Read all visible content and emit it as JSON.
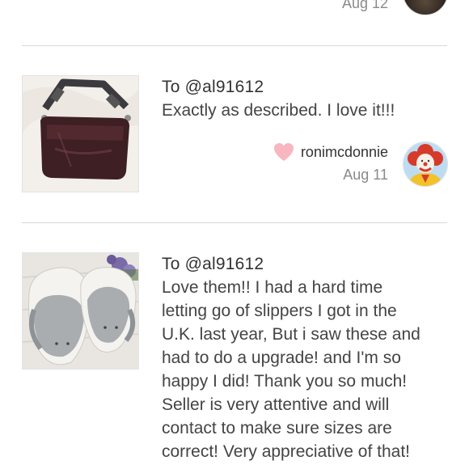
{
  "top": {
    "date": "Aug 12"
  },
  "reviews": [
    {
      "to": "To @al91612",
      "text": "Exactly as described. I love it!!!",
      "author": "ronimcdonnie",
      "date": "Aug 11",
      "liked": true,
      "heart_color": "#f7b6c0",
      "thumb_icon": "messenger-bag-photo",
      "avatar_icon": "clown-avatar"
    },
    {
      "to": "To @al91612",
      "text_lines": [
        "Love them!! I had a hard time",
        "letting go of slippers I got in the",
        "U.K. last year, But i saw these and",
        "had to do a upgrade! and I'm so",
        "happy I did! Thank you so much!",
        "Seller is very attentive and will",
        "contact to make sure sizes are",
        "correct! Very appreciative of that!"
      ],
      "thumb_icon": "slippers-photo"
    }
  ],
  "colors": {
    "divider": "#d9d9d9",
    "muted_text": "#8a8a8a",
    "heart": "#f7b6c0"
  }
}
